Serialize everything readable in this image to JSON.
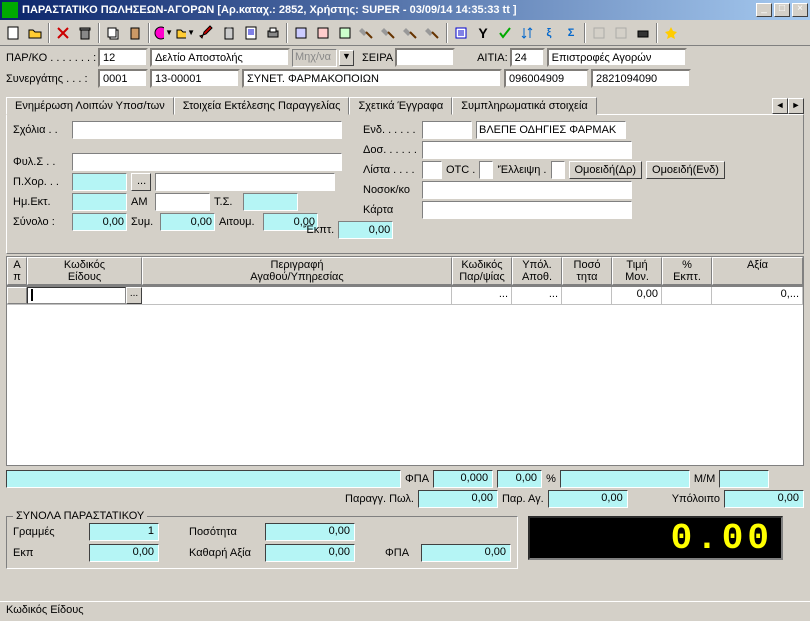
{
  "window": {
    "title": "ΠΑΡΑΣΤΑΤΙΚΟ ΠΩΛΗΣΕΩΝ-ΑΓΟΡΩΝ [Αρ.καταχ.: 2852, Χρήστης: SUPER - 03/09/14 14:35:33 tt ]"
  },
  "header": {
    "parko_label": "ΠΑΡ/ΚΟ . . . . . . . :",
    "parko_value": "12",
    "deltio": "Δελτίο Αποστολής",
    "mhx_label": "Μηχ/να",
    "seira_label": "ΣΕΙΡΑ",
    "seira_value": "",
    "aitia_label": "ΑΙΤΙΑ:",
    "aitia_value": "24",
    "epistrofes": "Επιστροφές Αγορών",
    "synergatis_label": "Συνεργάτης . . . :",
    "synergatis_code": "0001",
    "synergatis_code2": "13-00001",
    "synet_label": "ΣΥΝΕΤ. ΦΑΡΜΑΚΟΠΟΙΩΝ",
    "num1": "096004909",
    "num2": "2821094090"
  },
  "tabs": {
    "t1": "Ενημέρωση Λοιπών Υποσ/των",
    "t2": "Στοιχεία Εκτέλεσης Παραγγελίας",
    "t3": "Σχετικά Έγγραφα",
    "t4": "Συμπληρωματικά στοιχεία"
  },
  "panel": {
    "sxolia": "Σχόλια . .",
    "fyls": "Φυλ.Σ . .",
    "pxor": "Π.Χορ. . .",
    "hmekt": "Ημ.Εκτ.",
    "am": "ΑΜ",
    "ts": "Τ.Σ.",
    "synolo": "Σύνολο :",
    "synolo_val": "0,00",
    "sym": "Συμ.",
    "sym_val": "0,00",
    "aitoum": "Αιτουμ.",
    "aitoum_val": "0,00",
    "ekpt": "'Έκπτ.",
    "ekpt_val": "0,00",
    "end": "Ενδ. . . . . .",
    "vlepe": "ΒΛΕΠΕ ΟΔΗΓΙΕΣ ΦΑΡΜΑΚ",
    "dos": "Δοσ. . . . . .",
    "lista": "Λίστα . . . .",
    "otc": "OTC .",
    "elleipsi": "'Έλλειψη .",
    "omoeidi_dr": "Ομοειδή(Δρ)",
    "omoeidi_end": "Ομοειδή(Ενδ)",
    "nosokko": "Νοσοκ/κο",
    "karta": "Κάρτα"
  },
  "grid": {
    "cols": {
      "ap": "Α\nπ",
      "kodikos": "Κωδικός\nΕίδους",
      "perigrafi": "Περιγραφή\nΑγαθού/Υπηρεσίας",
      "kodpar": "Κωδικός\nΠαρ/ψίας",
      "ypol": "Υπόλ.\nΑποθ.",
      "poso": "Ποσό\nτητα",
      "timi": "Τιμή\nΜον.",
      "pekpt": "%\nΕκπτ.",
      "axia": "Αξία"
    },
    "row1": {
      "timi": "0,00",
      "axia": "0,..."
    }
  },
  "bottom": {
    "fpa_label": "ΦΠΑ",
    "fpa_val": "0,000",
    "fpa_pct": "0,00",
    "pct": "%",
    "mm_label": "Μ/Μ",
    "paragg_label": "Παραγγ. Πωλ.",
    "paragg_val": "0,00",
    "parag_label": "Παρ. Αγ.",
    "parag_val": "0,00",
    "ypoloipo_label": "Υπόλοιπο",
    "ypoloipo_val": "0,00"
  },
  "totals": {
    "title": "ΣΥΝΟΛΑ ΠΑΡΑΣΤΑΤΙΚΟΥ",
    "grammes_label": "Γραμμές",
    "grammes_val": "1",
    "ekp_label": "Εκπ",
    "ekp_val": "0,00",
    "posotita_label": "Ποσότητα",
    "posotita_val": "0,00",
    "kathari_label": "Καθαρή Αξία",
    "kathari_val": "0,00",
    "fpa2_label": "ΦΠΑ",
    "fpa2_val": "0,00",
    "display": "0.00"
  },
  "status": {
    "text": "Κωδικός Είδους"
  }
}
